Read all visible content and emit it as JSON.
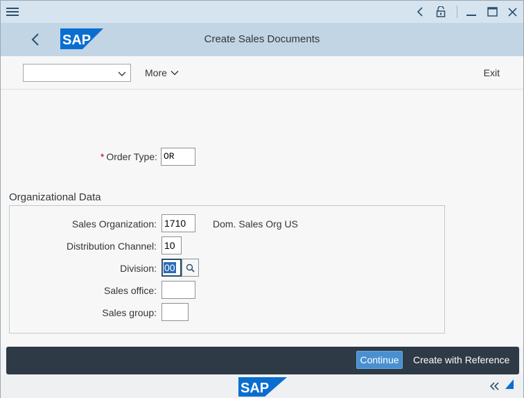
{
  "window": {
    "icons": [
      "menu-icon",
      "chevron-left-icon",
      "unlock-icon",
      "minimize-icon",
      "maximize-icon",
      "close-icon"
    ]
  },
  "shell": {
    "title": "Create Sales Documents",
    "logo_text": "SAP",
    "brand_color": "#0a6ed1"
  },
  "toolbar": {
    "select_value": "",
    "more_label": "More",
    "exit_label": "Exit"
  },
  "form": {
    "order_type": {
      "label": "Order Type:",
      "value": "OR",
      "required": true
    },
    "section_title": "Organizational Data",
    "sales_org": {
      "label": "Sales Organization:",
      "value": "1710",
      "description": "Dom. Sales Org US"
    },
    "dist_channel": {
      "label": "Distribution Channel:",
      "value": "10"
    },
    "division": {
      "label": "Division:",
      "value": "00"
    },
    "sales_office": {
      "label": "Sales office:",
      "value": ""
    },
    "sales_group": {
      "label": "Sales group:",
      "value": ""
    }
  },
  "footer": {
    "continue_label": "Continue",
    "reference_label": "Create with Reference",
    "logo_text": "SAP"
  }
}
